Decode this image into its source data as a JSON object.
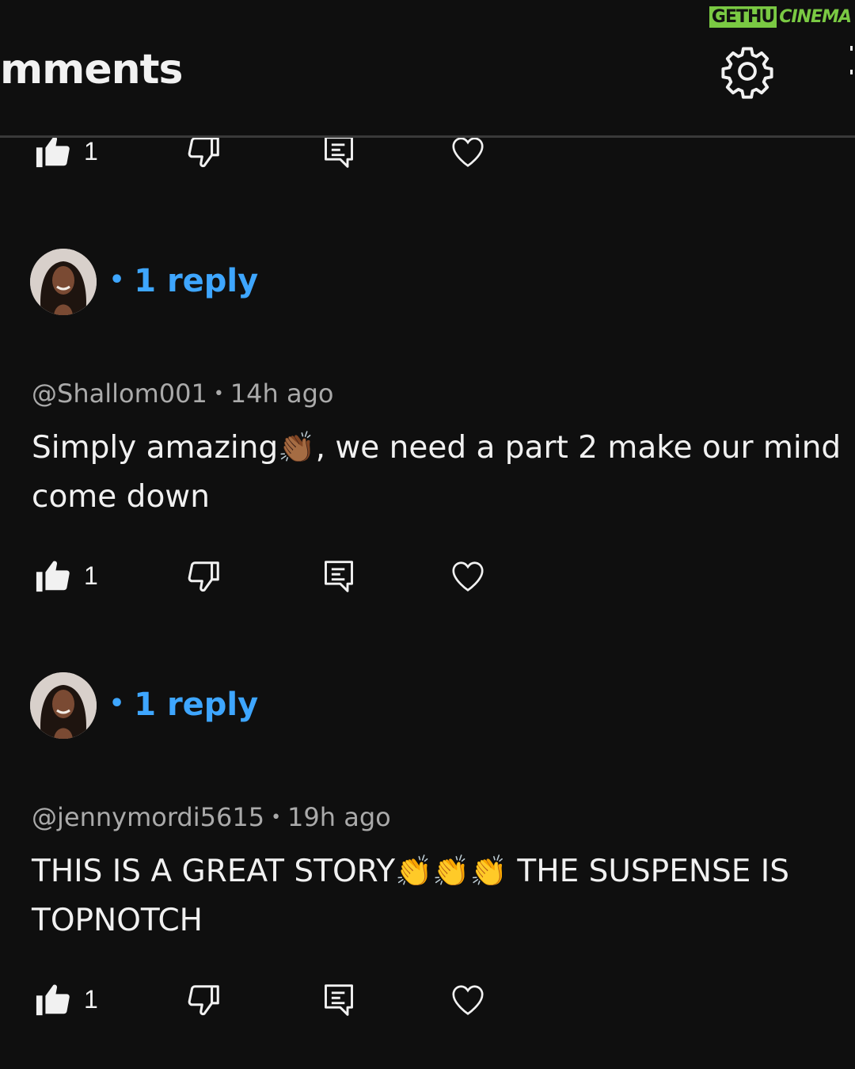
{
  "watermark": {
    "part1": "GETHU",
    "part2": "CINEMA"
  },
  "header": {
    "title": "mments",
    "settings_icon": "gear-icon"
  },
  "top_actions": {
    "like_count": "1"
  },
  "comments": [
    {
      "replies_label": "1 reply",
      "author": "@Shallom001",
      "time": "14h ago",
      "text_before": "Simply amazing",
      "emoji": "👏🏾",
      "text_after": ", we need a part 2 make our mind come down",
      "like_count": "1"
    },
    {
      "replies_label": "1 reply",
      "author": "@jennymordi5615",
      "time": "19h ago",
      "text_before": "THIS IS A GREAT STORY",
      "emoji": "👏👏👏",
      "text_after": " THE SUSPENSE  IS TOPNOTCH",
      "like_count": "1"
    }
  ],
  "colors": {
    "background": "#0f0f0f",
    "link": "#3ea6ff",
    "text": "#f1f1f1",
    "meta": "#aaaaaa",
    "brand": "#7ac943"
  }
}
